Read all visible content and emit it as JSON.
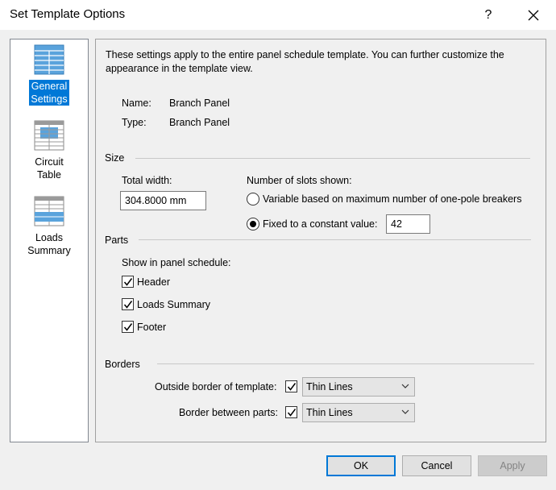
{
  "window": {
    "title": "Set Template Options",
    "help_label": "?",
    "close_label": "✕"
  },
  "sidebar": {
    "items": [
      {
        "label": "General\nSettings",
        "selected": true,
        "icon": "general-settings-icon"
      },
      {
        "label": "Circuit\nTable",
        "selected": false,
        "icon": "circuit-table-icon"
      },
      {
        "label": "Loads\nSummary",
        "selected": false,
        "icon": "loads-summary-icon"
      }
    ]
  },
  "general": {
    "intro": "These settings apply to the entire panel schedule template. You can further customize the appearance in the template view.",
    "name_label": "Name:",
    "name_value": "Branch Panel",
    "type_label": "Type:",
    "type_value": "Branch Panel"
  },
  "size": {
    "heading": "Size",
    "total_width_label": "Total width:",
    "total_width_value": "304.8000 mm",
    "slots_label": "Number of slots shown:",
    "variable_label": "Variable based on maximum number of one-pole breakers",
    "variable_selected": false,
    "fixed_label": "Fixed to a constant value:",
    "fixed_selected": true,
    "fixed_value": "42"
  },
  "parts": {
    "heading": "Parts",
    "show_label": "Show in panel schedule:",
    "header_label": "Header",
    "header_checked": true,
    "loads_label": "Loads Summary",
    "loads_checked": true,
    "footer_label": "Footer",
    "footer_checked": true
  },
  "borders": {
    "heading": "Borders",
    "outside_label": "Outside border of template:",
    "outside_checked": true,
    "outside_value": "Thin Lines",
    "between_label": "Border between parts:",
    "between_checked": true,
    "between_value": "Thin Lines"
  },
  "buttons": {
    "ok": "OK",
    "cancel": "Cancel",
    "apply": "Apply"
  },
  "colors": {
    "accent": "#0078d7",
    "icon_blue": "#5aa3dc",
    "icon_gray": "#9a9a9a"
  }
}
